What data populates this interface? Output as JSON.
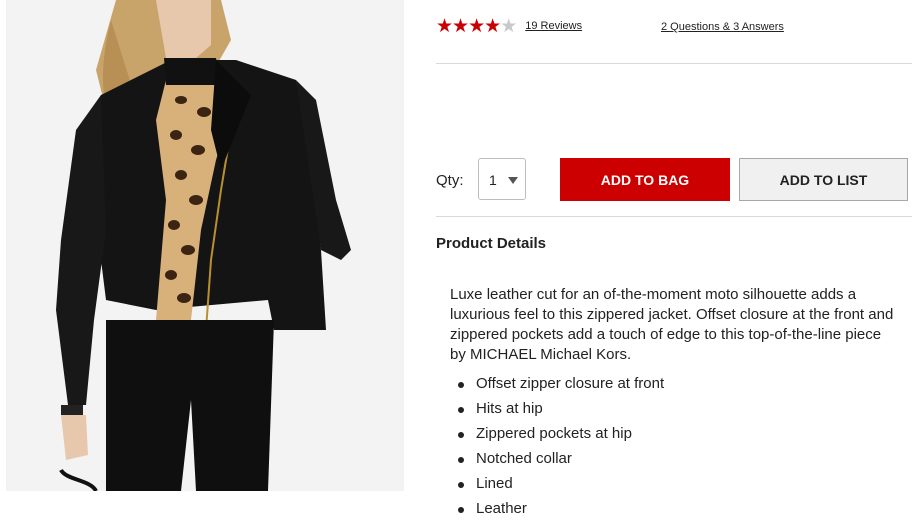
{
  "rating": {
    "stars_filled": 4,
    "stars_total": 5,
    "reviews_label": "19 Reviews",
    "qa_label": "2 Questions & 3 Answers",
    "star_color": "#cc0000",
    "star_empty_color": "#c9c9c9"
  },
  "purchase": {
    "qty_label": "Qty:",
    "qty_value": "1",
    "add_to_bag_label": "ADD TO BAG",
    "add_to_list_label": "ADD TO LIST",
    "add_to_bag_color": "#cc0000"
  },
  "details": {
    "heading": "Product Details",
    "description": "Luxe leather cut for an of-the-moment moto silhouette adds a luxurious feel to this zippered jacket. Offset closure at the front and zippered pockets add a touch of edge to this top-of-the-line piece by MICHAEL Michael Kors.",
    "features": [
      "Offset zipper closure at front",
      "Hits at hip",
      "Zippered pockets at hip",
      "Notched collar",
      "Lined",
      "Leather"
    ]
  },
  "image": {
    "subject": "model wearing black leather moto jacket over leopard print top"
  }
}
